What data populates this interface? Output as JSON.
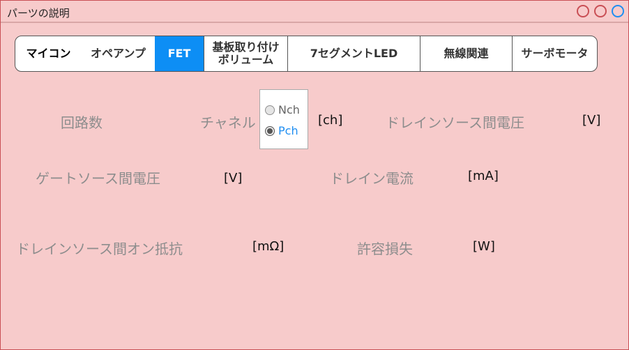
{
  "window": {
    "title": "パーツの説明"
  },
  "colors": {
    "background": "#f7cbcb",
    "window_border": "#c94f55",
    "active_tab": "#0d8ef5",
    "selected_radio_text": "#1f8ef1"
  },
  "tabs": [
    {
      "label": "マイコン",
      "active": false
    },
    {
      "label": "オペアンプ",
      "active": false
    },
    {
      "label": "FET",
      "active": true
    },
    {
      "label": "基板取り付け\nボリューム",
      "active": false
    },
    {
      "label": "7セグメントLED",
      "active": false
    },
    {
      "label": "無線関連",
      "active": false
    },
    {
      "label": "サーボモータ",
      "active": false
    }
  ],
  "fields": {
    "circuit_count": {
      "label": "回路数"
    },
    "channel": {
      "label": "チャネル",
      "unit": "[ch]"
    },
    "drain_source_voltage": {
      "label": "ドレインソース間電圧",
      "unit": "[V]"
    },
    "gate_source_voltage": {
      "label": "ゲートソース間電圧",
      "unit": "[V]"
    },
    "drain_current": {
      "label": "ドレイン電流",
      "unit": "[mA]"
    },
    "on_resistance": {
      "label": "ドレインソース間オン抵抗",
      "unit": "[mΩ]"
    },
    "power_dissipation": {
      "label": "許容損失",
      "unit": "[W]"
    }
  },
  "channel_options": [
    {
      "label": "Nch",
      "selected": false
    },
    {
      "label": "Pch",
      "selected": true
    }
  ]
}
